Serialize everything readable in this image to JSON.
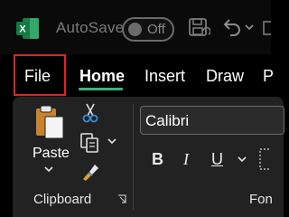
{
  "titlebar": {
    "autosave_label": "AutoSave",
    "toggle_state": "Off",
    "app_icon": "excel-logo",
    "quick_access": [
      "save-icon",
      "undo-icon",
      "chevron-down-icon"
    ]
  },
  "tabs": [
    {
      "label": "File",
      "highlighted": true
    },
    {
      "label": "Home",
      "selected": true
    },
    {
      "label": "Insert"
    },
    {
      "label": "Draw"
    },
    {
      "label": "P"
    }
  ],
  "ribbon": {
    "clipboard": {
      "paste_label": "Paste",
      "group_label": "Clipboard",
      "icons": [
        "paste-icon",
        "cut-icon",
        "copy-icon",
        "format-painter-icon",
        "dialog-launcher-icon"
      ]
    },
    "font": {
      "font_name": "Calibri",
      "bold": "B",
      "italic": "I",
      "underline": "U",
      "group_label": "Fon"
    }
  },
  "colors": {
    "excel_green": "#1d7b45",
    "home_underline": "#3fb17a",
    "file_box": "#e0242a",
    "ribbon_bg": "#222222"
  }
}
